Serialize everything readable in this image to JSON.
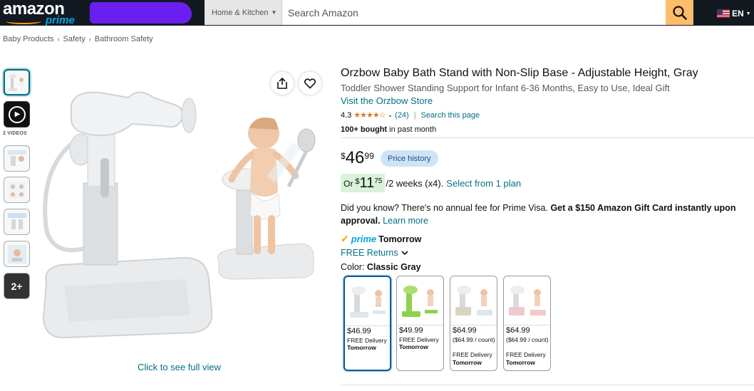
{
  "header": {
    "logo_text": "amazon",
    "logo_sub": "prime",
    "category": "Home & Kitchen",
    "search_placeholder": "Search Amazon",
    "language": "EN"
  },
  "breadcrumb": [
    "Baby Products",
    "Safety",
    "Bathroom Safety"
  ],
  "gallery": {
    "videos_label": "2 VIDEOS",
    "more_label": "2+",
    "full_view": "Click to see full view"
  },
  "product": {
    "title": "Orzbow Baby Bath Stand with Non-Slip Base - Adjustable Height, Gray",
    "subtitle": "Toddler Shower Standing Support for Infant 6-36 Months, Easy to Use, Ideal Gift",
    "store": "Visit the Orzbow Store",
    "rating": "4.3",
    "rating_value": 4.3,
    "rating_count": "(24)",
    "search_page": "Search this page",
    "bought_bold": "100+ bought",
    "bought_rest": "in past month"
  },
  "price": {
    "symbol": "$",
    "whole": "46",
    "fraction": "99",
    "history": "Price history"
  },
  "installment": {
    "or": "Or",
    "symbol": "$",
    "whole": "11",
    "fraction": "75",
    "terms": "/2 weeks (x4).",
    "link": "Select from 1 plan"
  },
  "promo": {
    "text": "Did you know? There's no annual fee for Prime Visa. ",
    "bold": "Get a $150 Amazon Gift Card instantly upon approval.",
    "link": "Learn more"
  },
  "delivery": {
    "prime": "prime",
    "day": "Tomorrow",
    "returns": "FREE Returns"
  },
  "color": {
    "label": "Color:",
    "value": "Classic Gray"
  },
  "swatches": [
    {
      "price": "$46.99",
      "unit": "",
      "delivery": "FREE Delivery",
      "day": "Tomorrow",
      "accent": "#d9d9d9"
    },
    {
      "price": "$49.99",
      "unit": "",
      "delivery": "FREE Delivery",
      "day": "Tomorrow",
      "accent": "#8fd14f"
    },
    {
      "price": "$64.99",
      "unit": "($64.99 / count)",
      "delivery": "FREE Delivery",
      "day": "Tomorrow",
      "accent": "#d9d4c0"
    },
    {
      "price": "$64.99",
      "unit": "($64.99 / count)",
      "delivery": "FREE Delivery",
      "day": "Tomorrow",
      "accent": "#f2c9c9"
    }
  ],
  "colors": {
    "header_bg": "#131921",
    "search_button": "#febd69",
    "link": "#007185",
    "star": "#de7921",
    "prime_blue": "#00a8e1"
  }
}
